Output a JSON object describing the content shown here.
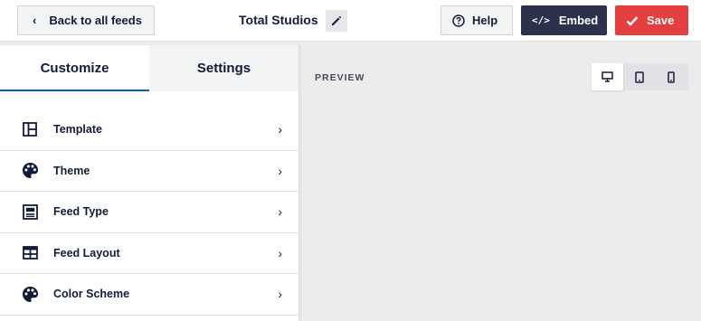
{
  "header": {
    "back_label": "Back to all feeds",
    "feed_title": "Total Studios",
    "help_label": "Help",
    "embed_label": "Embed",
    "save_label": "Save"
  },
  "sidebar": {
    "tabs": [
      {
        "label": "Customize",
        "active": true
      },
      {
        "label": "Settings",
        "active": false
      }
    ],
    "items": [
      {
        "label": "Template",
        "icon": "template-icon"
      },
      {
        "label": "Theme",
        "icon": "palette-icon"
      },
      {
        "label": "Feed Type",
        "icon": "feed-type-icon"
      },
      {
        "label": "Feed Layout",
        "icon": "layout-icon"
      },
      {
        "label": "Color Scheme",
        "icon": "palette-icon"
      }
    ]
  },
  "preview": {
    "label": "PREVIEW",
    "devices": [
      {
        "name": "desktop",
        "active": true
      },
      {
        "name": "tablet",
        "active": false
      },
      {
        "name": "mobile",
        "active": false
      }
    ]
  },
  "colors": {
    "save": "#e43e3e",
    "embed": "#2c324c",
    "tab_underline": "#0068a0",
    "text": "#141b38"
  }
}
